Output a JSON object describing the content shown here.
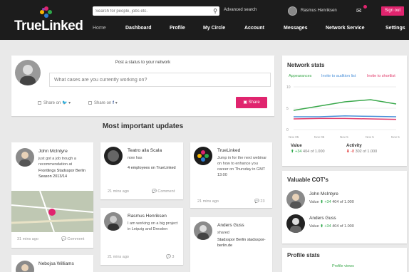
{
  "header": {
    "logo_text": "TrueLinked",
    "search_placeholder": "Search for people, jobs etc.",
    "advanced_search": "Advanced search",
    "user_name": "Rasmus Henriksen",
    "signout": "Sign out",
    "brand_color": "#e0246e"
  },
  "nav": [
    "Home",
    "Dashboard",
    "Profile",
    "My Circle",
    "Account",
    "Messages",
    "Network Service",
    "Settings"
  ],
  "status": {
    "title": "Post a status to your network",
    "placeholder": "What cases are you currently working on?",
    "share_twitter": "Share on",
    "share_facebook": "Share on",
    "share_button": "Share"
  },
  "updates_title": "Most important updates",
  "posts": [
    {
      "author": "John McIntyre",
      "text": "just got a job trough a recommendation at",
      "extra": "Frontlings Stadsspor Berlin Season 2013/14",
      "time": "31 mins ago",
      "action": "Comment"
    },
    {
      "author": "Teatro alla Scala",
      "text": "now has",
      "extra": "4 employees on TrueLinked",
      "time": "21 mins ago",
      "action": "Comment"
    },
    {
      "author": "TrueLinked",
      "text": "Jump in for the next webinar on how to enhance you career on Thursday in GMT 13:00",
      "time": "21 mins ago",
      "count": "23"
    },
    {
      "author": "Rasmus Henriksen",
      "text": "I am working on a big project in Leipzig and Dresden",
      "time": "21 mins ago",
      "count": "3"
    },
    {
      "author": "Anders Guss",
      "text": "shared",
      "extra": "Stadsspor Berlin stadsspor-berlin.de"
    },
    {
      "author": "Nebojsa Williams"
    }
  ],
  "network_stats": {
    "title": "Network stats",
    "legend": [
      "Appearances",
      "Invite to audition list",
      "Invite to shortlist"
    ],
    "legend_colors": [
      "#3aa84b",
      "#4a90d9",
      "#e03a6a"
    ],
    "y_ticks": [
      "10",
      "5",
      "0"
    ],
    "x_ticks": [
      "Nov 05",
      "Nov 05",
      "Nov 5",
      "Nov 5",
      "Nov 5"
    ],
    "value_label": "Value",
    "value_change": "+34",
    "value_rank": "404 of 1.000",
    "activity_label": "Activity",
    "activity_change": "-8",
    "activity_rank": "302 of 1.000"
  },
  "chart_data": {
    "type": "line",
    "x": [
      "Nov 05",
      "Nov 05",
      "Nov 5",
      "Nov 5",
      "Nov 5"
    ],
    "ylim": [
      0,
      10
    ],
    "series": [
      {
        "name": "Appearances",
        "color": "#3aa84b",
        "values": [
          4.5,
          5.5,
          6.5,
          7,
          6
        ]
      },
      {
        "name": "Invite to audition list",
        "color": "#4a90d9",
        "values": [
          3,
          3,
          3.2,
          3.1,
          3
        ]
      },
      {
        "name": "Invite to shortlist",
        "color": "#e03a6a",
        "values": [
          2.5,
          2.6,
          2.6,
          2.5,
          2.4
        ]
      }
    ]
  },
  "valuable_cots": {
    "title": "Valuable COT's",
    "people": [
      {
        "name": "John McIntyre",
        "value_label": "Value",
        "change": "+34",
        "rank": "404 of 1.000"
      },
      {
        "name": "Anders Guss",
        "value_label": "Value",
        "change": "+34",
        "rank": "404 of 1.000"
      }
    ]
  },
  "profile_stats": {
    "title": "Profile stats",
    "subtitle": "Profile views"
  }
}
